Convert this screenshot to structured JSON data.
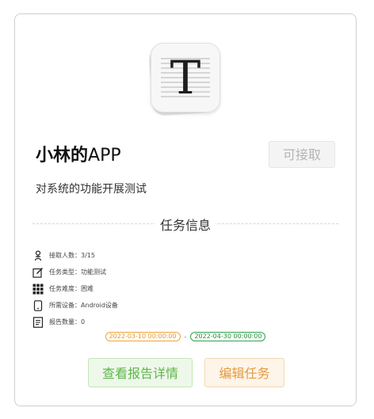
{
  "app": {
    "title_bold": "小林的",
    "title_rest": "APP",
    "description": "对系统的功能开展测试",
    "icon_letter": "T",
    "accept_label": "可接取"
  },
  "section_title": "任务信息",
  "info": [
    {
      "icon": "person-icon",
      "label": "接取人数：",
      "value": "3/15"
    },
    {
      "icon": "edit-icon",
      "label": "任务类型：",
      "value": "功能测试"
    },
    {
      "icon": "grid-icon",
      "label": "任务难度：",
      "value": "困难"
    },
    {
      "icon": "device-icon",
      "label": "所需设备：",
      "value": "Android设备"
    },
    {
      "icon": "document-icon",
      "label": "报告数量：",
      "value": "0"
    }
  ],
  "dates": {
    "start": "2022-03-10 00:00:00",
    "separator": "-",
    "end": "2022-04-30 00:00:00"
  },
  "buttons": {
    "detail": "查看报告详情",
    "edit": "编辑任务"
  },
  "colors": {
    "accent_green": "#5fb54c",
    "accent_orange": "#e49b3d",
    "disabled_text": "#b4b4b4"
  }
}
